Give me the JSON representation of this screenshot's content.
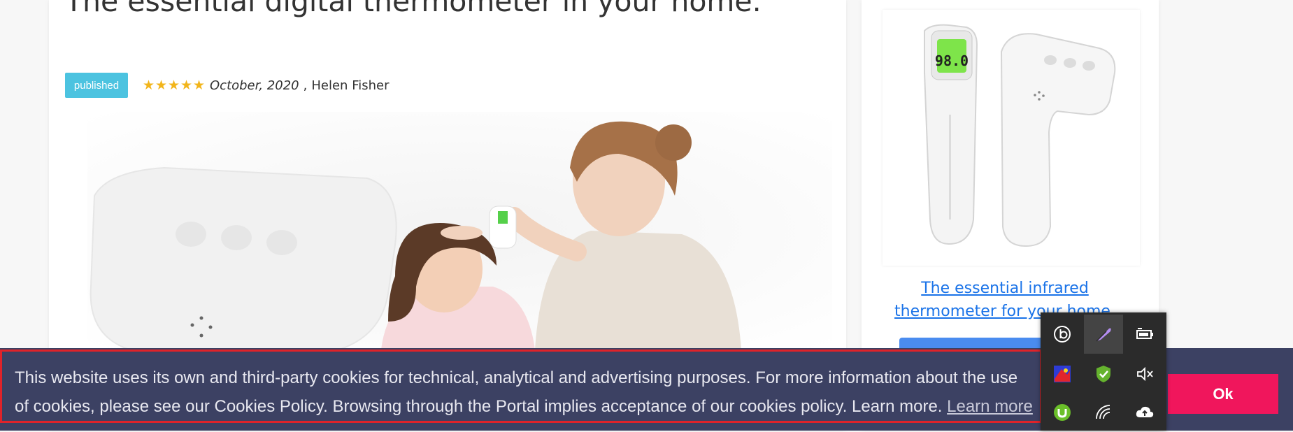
{
  "article": {
    "title": "The essential digital thermometer in your home.",
    "status_badge": "published",
    "rating_stars": 5,
    "date": "October, 2020",
    "author_separator": ",",
    "author": "Helen Fisher"
  },
  "sidebar": {
    "product_link": "The essential infrared thermometer for your home."
  },
  "cookie_banner": {
    "message": "This website uses its own and third-party cookies for technical, analytical and advertising purposes. For more information about the use of cookies, please see our Cookies Policy. Browsing through the Portal implies acceptance of our cookies policy. Learn more.",
    "learn_more_link": "Learn more",
    "ok_button": "Ok"
  },
  "thermometer_display": "98.0",
  "colors": {
    "badge": "#4cc3e0",
    "star": "#f2b51b",
    "link": "#1a73e8",
    "cookie_bg": "#3c4163",
    "ok_button": "#f0165c",
    "tray_bg": "#2b2b2b"
  },
  "system_tray": {
    "icons": [
      "beats-icon",
      "feather-pen-icon",
      "battery-icon",
      "color-app-icon",
      "security-check-icon",
      "speaker-muted-icon",
      "utorrent-icon",
      "wifi-icon",
      "cloud-upload-icon"
    ]
  }
}
